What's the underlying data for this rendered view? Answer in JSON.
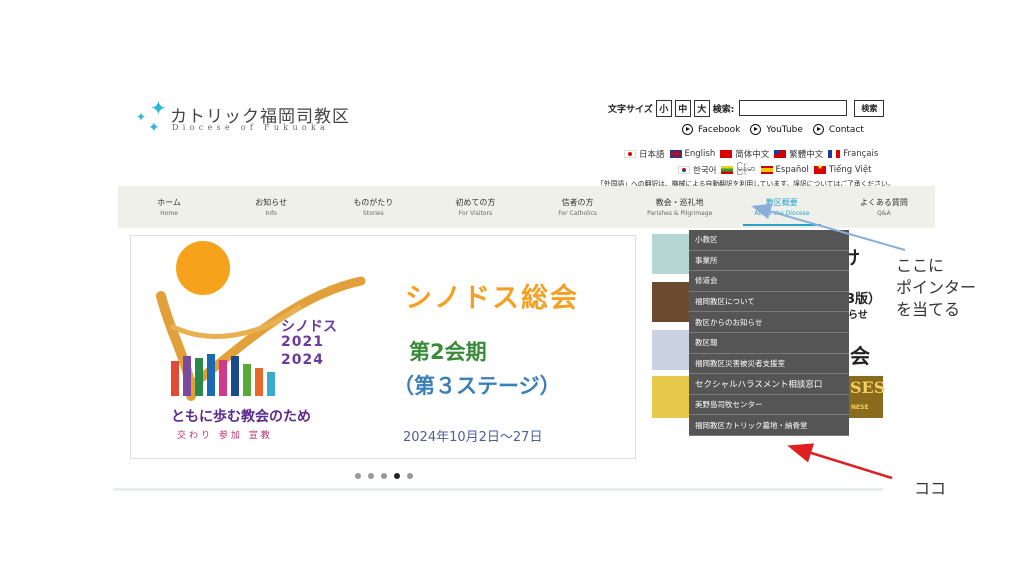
{
  "header": {
    "logo_title": "カトリック福岡司教区",
    "logo_sub": "Diocese of Fukuoka",
    "font_size_label": "文字サイズ",
    "font_small": "小",
    "font_medium": "中",
    "font_large": "大",
    "search_label": "検索:",
    "search_value": "",
    "search_button": "検索",
    "social": [
      {
        "label": "Facebook"
      },
      {
        "label": "YouTube"
      },
      {
        "label": "Contact"
      }
    ],
    "languages_row1": [
      "日本語",
      "English",
      "简体中文",
      "繁體中文",
      "Français"
    ],
    "languages_row2": [
      "한국어",
      "မြန်မာ",
      "Español",
      "Tiếng Việt"
    ],
    "translate_note": "「外国語」への翻訳は、機械による自動翻訳を利用しています。誤訳についてはご了承ください。"
  },
  "nav": [
    {
      "label": "ホーム",
      "sub": "Home"
    },
    {
      "label": "お知らせ",
      "sub": "Info"
    },
    {
      "label": "ものがたり",
      "sub": "Stories"
    },
    {
      "label": "初めての方",
      "sub": "For Visitors"
    },
    {
      "label": "信者の方",
      "sub": "For Catholics"
    },
    {
      "label": "教会・巡礼地",
      "sub": "Parishes & Pilgrimage"
    },
    {
      "label": "教区概要",
      "sub": "About the Diocese"
    },
    {
      "label": "よくある質問",
      "sub": "Q&A"
    }
  ],
  "dropdown": [
    "小教区",
    "事業所",
    "修道会",
    "福岡教区について",
    "教区からのお知らせ",
    "教区報",
    "福岡教区災害被災者支援室",
    "セクシャルハラスメント相談窓口",
    "美野島司牧センター",
    "福岡教区カトリック墓地・納骨堂"
  ],
  "slide": {
    "title": "シノドス総会",
    "session": "第2会期",
    "stage": "（第３ステージ）",
    "date": "2024年10月2日～27日",
    "synod_word": "シノドス",
    "synod_years_1": "2021",
    "synod_years_2": "2024",
    "motto": "ともに歩む教会のため",
    "motto_sub": "交わり 参加 宣教"
  },
  "side_banners": {
    "t1": "け",
    "t2": "3版）",
    "t3": "らせ",
    "t4": "会",
    "t5": "SES",
    "t6": "NESE"
  },
  "slider_dots": {
    "count": 5,
    "active": 4
  },
  "annotations": {
    "pointer_line1": "ここに",
    "pointer_line2": "ポインター",
    "pointer_line3": "を当てる",
    "here": "ココ"
  },
  "colors": {
    "accent": "#2aa2c8",
    "nav_bg": "#f0f0eb",
    "dropdown_bg": "#555555",
    "arrow_blue": "#8aaed8",
    "arrow_red": "#e02020"
  }
}
